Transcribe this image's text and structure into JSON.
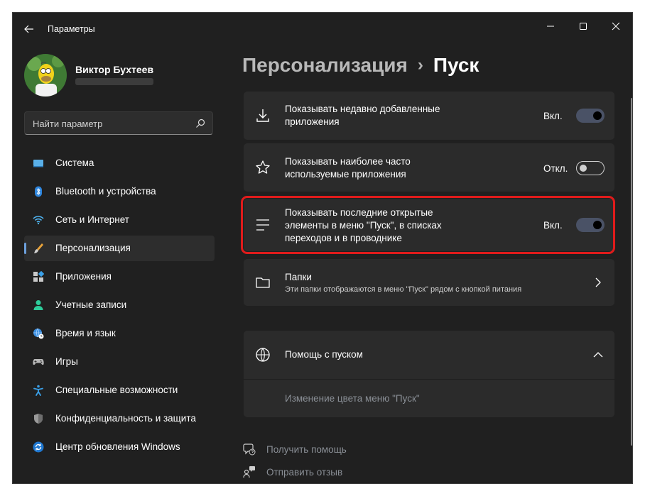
{
  "window": {
    "title": "Параметры"
  },
  "user": {
    "name": "Виктор Бухтеев"
  },
  "search": {
    "placeholder": "Найти параметр"
  },
  "nav": [
    {
      "label": "Система",
      "icon": "monitor-icon"
    },
    {
      "label": "Bluetooth и устройства",
      "icon": "bluetooth-icon"
    },
    {
      "label": "Сеть и Интернет",
      "icon": "wifi-icon"
    },
    {
      "label": "Персонализация",
      "icon": "brush-icon",
      "active": true
    },
    {
      "label": "Приложения",
      "icon": "apps-icon"
    },
    {
      "label": "Учетные записи",
      "icon": "person-icon"
    },
    {
      "label": "Время и язык",
      "icon": "globe-clock-icon"
    },
    {
      "label": "Игры",
      "icon": "gamepad-icon"
    },
    {
      "label": "Специальные возможности",
      "icon": "accessibility-icon"
    },
    {
      "label": "Конфиденциальность и защита",
      "icon": "shield-icon"
    },
    {
      "label": "Центр обновления Windows",
      "icon": "update-icon"
    }
  ],
  "breadcrumb": {
    "parent": "Персонализация",
    "separator": "›",
    "current": "Пуск"
  },
  "settings": {
    "recent_apps": {
      "line1": "Показывать недавно добавленные",
      "line2": "приложения",
      "state": "Вкл.",
      "on": true
    },
    "most_used": {
      "line1": "Показывать наиболее часто",
      "line2": "используемые приложения",
      "state": "Откл.",
      "on": false
    },
    "recent_items": {
      "line1": "Показывать последние открытые",
      "line2": "элементы в меню \"Пуск\", в списках",
      "line3": "переходов и в проводнике",
      "state": "Вкл.",
      "on": true
    },
    "folders": {
      "title": "Папки",
      "desc": "Эти папки отображаются в меню \"Пуск\" рядом с кнопкой питания"
    }
  },
  "help": {
    "title": "Помощь с пуском",
    "link": "Изменение цвета меню \"Пуск\""
  },
  "footer": {
    "get_help": "Получить помощь",
    "feedback": "Отправить отзыв"
  },
  "colors": {
    "accent": "#6ca0dc",
    "highlight": "#e01b1b",
    "toggle_on": "#4a5266"
  }
}
